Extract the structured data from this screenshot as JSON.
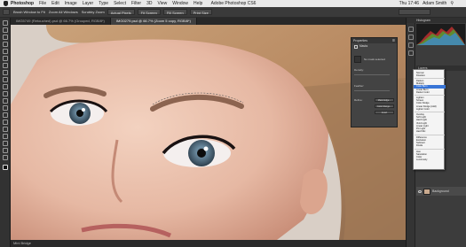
{
  "menubar": {
    "app_name": "Photoshop",
    "items": [
      "File",
      "Edit",
      "Image",
      "Layer",
      "Type",
      "Select",
      "Filter",
      "3D",
      "View",
      "Window",
      "Help"
    ],
    "window_title": "Adobe Photoshop CS6",
    "clock": "Thu 17:46",
    "user": "Adam Smith"
  },
  "options_bar": {
    "buttons": [
      "",
      "Brush Window to Fit",
      "Zoom All Windows",
      "Scrubby Zoom",
      "Actual Pixels",
      "Fit Screen",
      "Fill Screen",
      "Print Size"
    ]
  },
  "tabs": [
    "IMG5749 (Retouched).psd @ 66.7% (Grouped, RGB/8*)",
    "IMG0279.psd @ 66.7% (Zoom 5 copy, RGB/8*)"
  ],
  "status_bar": {
    "text": "Mini Bridge"
  },
  "properties_panel": {
    "title": "Properties",
    "section": "Masks",
    "no_mask": "No mask selected",
    "density_label": "Density:",
    "feather_label": "Feather:",
    "refine_label": "Refine:",
    "buttons": [
      "Mask Edge...",
      "Color Range...",
      "Invert"
    ]
  },
  "right_panel": {
    "histogram_title": "Histogram",
    "layers_title": "Layers",
    "background_layer": "Background"
  },
  "blend_modes": {
    "selected": "Color Burn",
    "groups": [
      [
        "Normal",
        "Dissolve"
      ],
      [
        "Darken",
        "Multiply",
        "Color Burn",
        "Linear Burn",
        "Darker Color"
      ],
      [
        "Lighten",
        "Screen",
        "Color Dodge",
        "Linear Dodge (Add)",
        "Lighter Color"
      ],
      [
        "Overlay",
        "Soft Light",
        "Hard Light",
        "Vivid Light",
        "Linear Light",
        "Pin Light",
        "Hard Mix"
      ],
      [
        "Difference",
        "Exclusion",
        "Subtract",
        "Divide"
      ],
      [
        "Hue",
        "Saturation",
        "Color",
        "Luminosity"
      ]
    ]
  },
  "colors": {
    "ui_dark": "#3a3a3a",
    "selection": "#3875d7",
    "menubar": "#e9e9e9"
  },
  "icons": {
    "toolbar": [
      "move-icon",
      "marquee-icon",
      "lasso-icon",
      "quick-select-icon",
      "crop-icon",
      "eyedropper-icon",
      "healing-icon",
      "brush-icon",
      "clone-stamp-icon",
      "history-brush-icon",
      "eraser-icon",
      "gradient-icon",
      "blur-icon",
      "dodge-icon",
      "pen-icon",
      "type-icon",
      "path-select-icon",
      "shape-icon",
      "hand-icon",
      "zoom-icon"
    ]
  }
}
